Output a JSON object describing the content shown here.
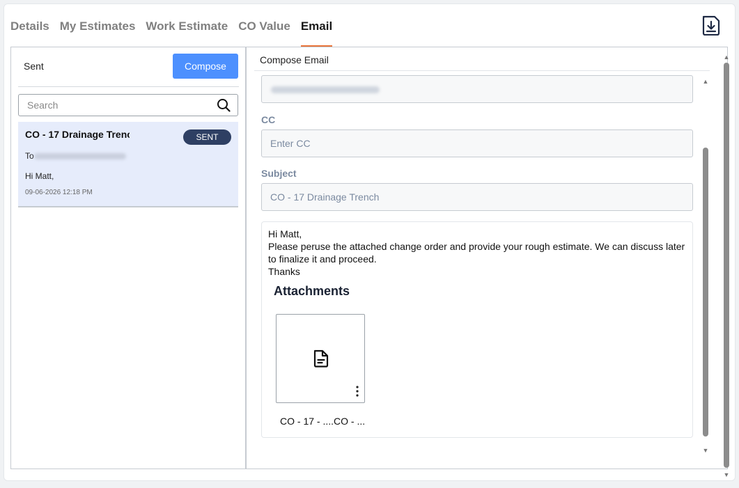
{
  "tabs": [
    {
      "label": "Details",
      "active": false
    },
    {
      "label": "My Estimates",
      "active": false
    },
    {
      "label": "Work Estimate",
      "active": false
    },
    {
      "label": "CO Value",
      "active": false
    },
    {
      "label": "Email",
      "active": true
    }
  ],
  "header": {
    "download_icon": "download-document-icon"
  },
  "sidebar": {
    "sent_label": "Sent",
    "compose_label": "Compose",
    "search_placeholder": "Search",
    "items": [
      {
        "subject": "CO - 17 Drainage Trencl",
        "badge": "SENT",
        "to_label": "To",
        "greeting": "Hi Matt,",
        "date": "09-06-2026 12:18 PM"
      }
    ]
  },
  "compose": {
    "title": "Compose Email",
    "cc_label": "CC",
    "cc_placeholder": "Enter CC",
    "subject_label": "Subject",
    "subject_value": "CO - 17 Drainage Trench",
    "body_lines": [
      "Hi Matt,",
      "Please peruse the attached change order and provide your rough estimate. We can discuss later to finalize it and proceed.",
      "Thanks"
    ],
    "attachments_title": "Attachments",
    "attachments": [
      {
        "name": "CO - 17 - ....CO - ...",
        "icon": "document-icon"
      }
    ]
  },
  "colors": {
    "accent": "#e8743b",
    "primary_button": "#4d90fe",
    "badge_bg": "#2e3f63",
    "selected_item_bg": "#e6ecfb",
    "label_muted": "#7b8aa0"
  }
}
